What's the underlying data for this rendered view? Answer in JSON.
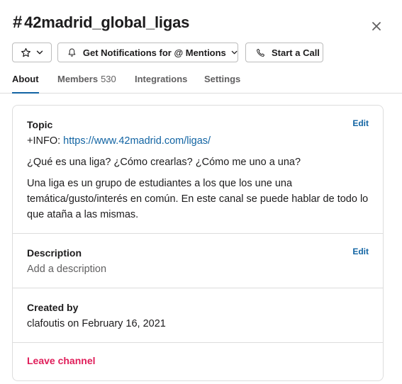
{
  "header": {
    "channel_prefix": "#",
    "channel_name": "42madrid_global_ligas",
    "close_icon": "close-icon"
  },
  "toolbar": {
    "star_icon": "star-icon",
    "notifications_label": "Get Notifications for @ Mentions",
    "call_label": "Start a Call"
  },
  "tabs": [
    {
      "label": "About",
      "active": true
    },
    {
      "label": "Members",
      "count": "530"
    },
    {
      "label": "Integrations"
    },
    {
      "label": "Settings"
    }
  ],
  "topic": {
    "heading": "Topic",
    "edit_label": "Edit",
    "info_prefix": "+INFO:",
    "info_link": "https://www.42madrid.com/ligas/",
    "question": "¿Qué es una liga? ¿Cómo crearlas? ¿Cómo me uno a una?",
    "body": "Una liga es un grupo de estudiantes a los que los une una temática/gusto/interés en común. En este canal se puede hablar de todo lo que ataña a las mismas."
  },
  "description": {
    "heading": "Description",
    "edit_label": "Edit",
    "placeholder": "Add a description"
  },
  "created": {
    "heading": "Created by",
    "value": "clafoutis on February 16, 2021"
  },
  "leave": {
    "label": "Leave channel"
  },
  "colors": {
    "accent": "#1264a3",
    "danger": "#e01e5a",
    "text": "#1d1c1d",
    "muted": "#616061",
    "border": "#dddddd"
  }
}
